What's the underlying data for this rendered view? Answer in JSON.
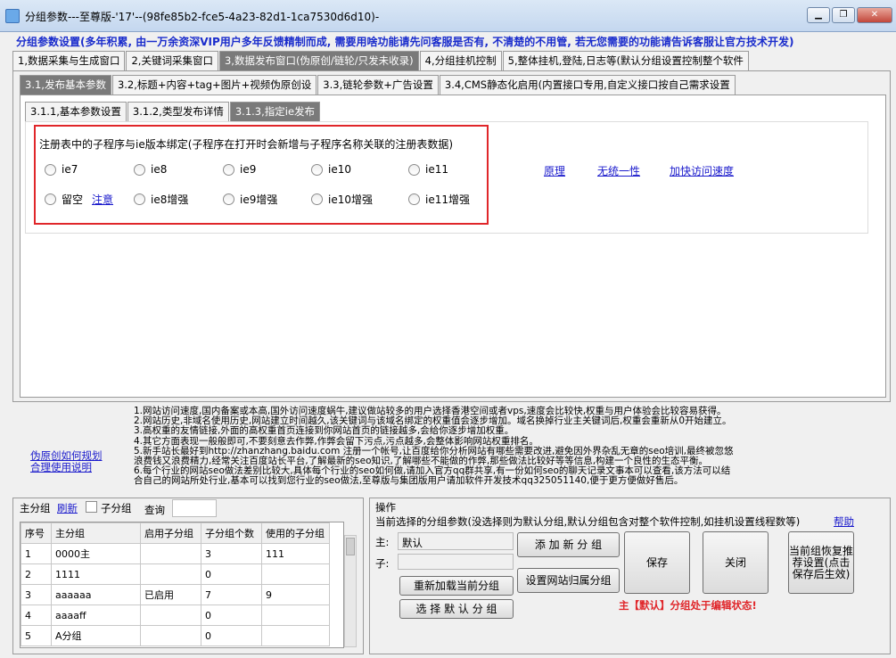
{
  "window": {
    "title": "分组参数---至尊版-'17'--(98fe85b2-fce5-4a23-82d1-1ca7530d6d10)-",
    "controls": [
      "▁",
      "❐",
      "✕"
    ]
  },
  "notice": "分组参数设置(多年积累, 由一万余资深VIP用户多年反馈精制而成, 需要用啥功能请先问客服是否有, 不清楚的不用管, 若无您需要的功能请告诉客服让官方技术开发)",
  "main_tabs": [
    {
      "label": "1,数据采集与生成窗口",
      "selected": false
    },
    {
      "label": "2,关键词采集窗口",
      "selected": false
    },
    {
      "label": "3,数据发布窗口(伪原创/链轮/只发未收录)",
      "selected": true
    },
    {
      "label": "4,分组挂机控制",
      "selected": false
    },
    {
      "label": "5,整体挂机,登陆,日志等(默认分组设置控制整个软件",
      "selected": false
    }
  ],
  "sub_tabs": [
    {
      "label": "3.1,发布基本参数",
      "selected": true
    },
    {
      "label": "3.2,标题+内容+tag+图片+视频伪原创设",
      "selected": false
    },
    {
      "label": "3.3,链轮参数+广告设置",
      "selected": false
    },
    {
      "label": "3.4,CMS静态化启用(内置接口专用,自定义接口按自己需求设置",
      "selected": false
    }
  ],
  "sub_sub_tabs": [
    {
      "label": "3.1.1,基本参数设置",
      "selected": false
    },
    {
      "label": "3.1.2,类型发布详情",
      "selected": false
    },
    {
      "label": "3.1.3,指定ie发布",
      "selected": true
    }
  ],
  "ie_group": {
    "caption": "注册表中的子程序与ie版本绑定(子程序在打开时会新增与子程序名称关联的注册表数据)",
    "row1": [
      "ie7",
      "ie8",
      "ie9",
      "ie10",
      "ie11"
    ],
    "row2": [
      "留空",
      "ie8增强",
      "ie9增强",
      "ie10增强",
      "ie11增强"
    ],
    "note_link": "注意",
    "links": [
      "原理",
      "无统一性",
      "加快访问速度"
    ]
  },
  "help_links": [
    "伪原创如何规划",
    "合理使用说明"
  ],
  "info_lines": [
    "1.网站访问速度,国内备案或本高,国外访问速度蜗牛,建议做站较多的用户选择香港空间或者vps,速度会比较快,权重与用户体验会比较容易获得。",
    "2.网站历史,非域名使用历史,网站建立时间越久,该关键词与该域名绑定的权重值会逐步增加。域名换掉行业主关键词后,权重会重新从0开始建立。",
    "3.高权重的友情链接,外面的高权重首页连接到你网站首页的链接越多,会给你逐步增加权重。",
    "4.其它方面表现一般般即可,不要刻意去作弊,作弊会留下污点,污点越多,会整体影响网站权重排名。",
    "5.新手站长最好到http://zhanzhang.baidu.com 注册一个帐号,让百度给你分析网站有哪些需要改进,避免因外界杂乱无章的seo培训,最终被忽悠",
    "浪费钱又浪费精力,经常关注百度站长平台,了解最新的seo知识,了解哪些不能做的作弊,那些做法比较好等等信息,构建一个良性的生态平衡。",
    "6.每个行业的网站seo做法差别比较大,具体每个行业的seo如何做,请加入官方qq群共享,有一份如何seo的聊天记录文事本可以查看,该方法可以结",
    "合自己的网站所处行业,基本可以找到您行业的seo做法,至尊版与集团版用户请加软件开发技术qq325051140,便于更方便做好售后。"
  ],
  "group_panel": {
    "label": "主分组",
    "refresh": "刷新",
    "sub_group_checkbox": "子分组",
    "query_label": "查询",
    "query_value": "",
    "columns": [
      "序号",
      "主分组",
      "启用子分组",
      "子分组个数",
      "使用的子分组"
    ],
    "rows": [
      [
        "1",
        "0000主",
        "",
        "3",
        "111"
      ],
      [
        "2",
        "1111",
        "",
        "0",
        ""
      ],
      [
        "3",
        "aaaaaa",
        "已启用",
        "7",
        "9"
      ],
      [
        "4",
        "aaaaff",
        "",
        "0",
        ""
      ],
      [
        "5",
        "A分组",
        "",
        "0",
        ""
      ]
    ]
  },
  "ops": {
    "title": "操作",
    "desc": "当前选择的分组参数(没选择则为默认分组,默认分组包含对整个软件控制,如挂机设置线程数等)",
    "help": "帮助",
    "main_label": "主:",
    "main_value": "默认",
    "sub_label": "子:",
    "sub_value": "",
    "btn_add": "添 加 新 分 组",
    "btn_site": "设置网站归属分组",
    "btn_reload": "重新加载当前分组",
    "btn_default": "选 择 默 认 分 组",
    "btn_save": "保存",
    "btn_close": "关闭",
    "btn_restore": "当前组恢复推荐设置(点击保存后生效)",
    "status": "主【默认】分组处于编辑状态!",
    "status_color": "#e0262a"
  },
  "colors": {
    "accent": "#1a2ccc",
    "link": "#1a1acc",
    "alert": "#e0262a"
  }
}
